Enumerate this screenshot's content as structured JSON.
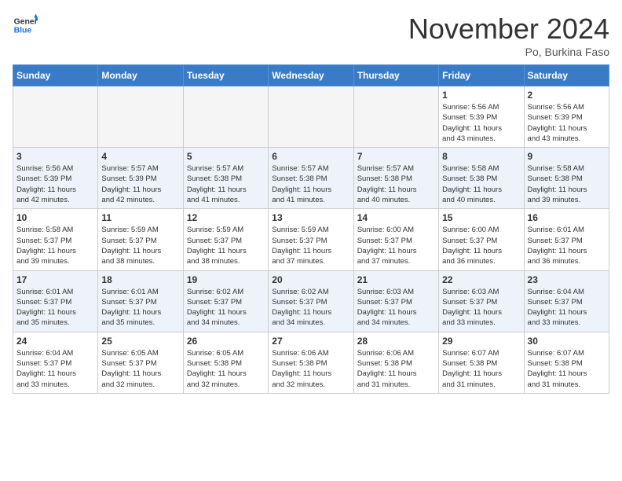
{
  "header": {
    "logo": {
      "general": "General",
      "blue": "Blue"
    },
    "month": "November 2024",
    "location": "Po, Burkina Faso"
  },
  "weekdays": [
    "Sunday",
    "Monday",
    "Tuesday",
    "Wednesday",
    "Thursday",
    "Friday",
    "Saturday"
  ],
  "weeks": [
    [
      {
        "day": "",
        "info": ""
      },
      {
        "day": "",
        "info": ""
      },
      {
        "day": "",
        "info": ""
      },
      {
        "day": "",
        "info": ""
      },
      {
        "day": "",
        "info": ""
      },
      {
        "day": "1",
        "info": "Sunrise: 5:56 AM\nSunset: 5:39 PM\nDaylight: 11 hours\nand 43 minutes."
      },
      {
        "day": "2",
        "info": "Sunrise: 5:56 AM\nSunset: 5:39 PM\nDaylight: 11 hours\nand 43 minutes."
      }
    ],
    [
      {
        "day": "3",
        "info": "Sunrise: 5:56 AM\nSunset: 5:39 PM\nDaylight: 11 hours\nand 42 minutes."
      },
      {
        "day": "4",
        "info": "Sunrise: 5:57 AM\nSunset: 5:39 PM\nDaylight: 11 hours\nand 42 minutes."
      },
      {
        "day": "5",
        "info": "Sunrise: 5:57 AM\nSunset: 5:38 PM\nDaylight: 11 hours\nand 41 minutes."
      },
      {
        "day": "6",
        "info": "Sunrise: 5:57 AM\nSunset: 5:38 PM\nDaylight: 11 hours\nand 41 minutes."
      },
      {
        "day": "7",
        "info": "Sunrise: 5:57 AM\nSunset: 5:38 PM\nDaylight: 11 hours\nand 40 minutes."
      },
      {
        "day": "8",
        "info": "Sunrise: 5:58 AM\nSunset: 5:38 PM\nDaylight: 11 hours\nand 40 minutes."
      },
      {
        "day": "9",
        "info": "Sunrise: 5:58 AM\nSunset: 5:38 PM\nDaylight: 11 hours\nand 39 minutes."
      }
    ],
    [
      {
        "day": "10",
        "info": "Sunrise: 5:58 AM\nSunset: 5:37 PM\nDaylight: 11 hours\nand 39 minutes."
      },
      {
        "day": "11",
        "info": "Sunrise: 5:59 AM\nSunset: 5:37 PM\nDaylight: 11 hours\nand 38 minutes."
      },
      {
        "day": "12",
        "info": "Sunrise: 5:59 AM\nSunset: 5:37 PM\nDaylight: 11 hours\nand 38 minutes."
      },
      {
        "day": "13",
        "info": "Sunrise: 5:59 AM\nSunset: 5:37 PM\nDaylight: 11 hours\nand 37 minutes."
      },
      {
        "day": "14",
        "info": "Sunrise: 6:00 AM\nSunset: 5:37 PM\nDaylight: 11 hours\nand 37 minutes."
      },
      {
        "day": "15",
        "info": "Sunrise: 6:00 AM\nSunset: 5:37 PM\nDaylight: 11 hours\nand 36 minutes."
      },
      {
        "day": "16",
        "info": "Sunrise: 6:01 AM\nSunset: 5:37 PM\nDaylight: 11 hours\nand 36 minutes."
      }
    ],
    [
      {
        "day": "17",
        "info": "Sunrise: 6:01 AM\nSunset: 5:37 PM\nDaylight: 11 hours\nand 35 minutes."
      },
      {
        "day": "18",
        "info": "Sunrise: 6:01 AM\nSunset: 5:37 PM\nDaylight: 11 hours\nand 35 minutes."
      },
      {
        "day": "19",
        "info": "Sunrise: 6:02 AM\nSunset: 5:37 PM\nDaylight: 11 hours\nand 34 minutes."
      },
      {
        "day": "20",
        "info": "Sunrise: 6:02 AM\nSunset: 5:37 PM\nDaylight: 11 hours\nand 34 minutes."
      },
      {
        "day": "21",
        "info": "Sunrise: 6:03 AM\nSunset: 5:37 PM\nDaylight: 11 hours\nand 34 minutes."
      },
      {
        "day": "22",
        "info": "Sunrise: 6:03 AM\nSunset: 5:37 PM\nDaylight: 11 hours\nand 33 minutes."
      },
      {
        "day": "23",
        "info": "Sunrise: 6:04 AM\nSunset: 5:37 PM\nDaylight: 11 hours\nand 33 minutes."
      }
    ],
    [
      {
        "day": "24",
        "info": "Sunrise: 6:04 AM\nSunset: 5:37 PM\nDaylight: 11 hours\nand 33 minutes."
      },
      {
        "day": "25",
        "info": "Sunrise: 6:05 AM\nSunset: 5:37 PM\nDaylight: 11 hours\nand 32 minutes."
      },
      {
        "day": "26",
        "info": "Sunrise: 6:05 AM\nSunset: 5:38 PM\nDaylight: 11 hours\nand 32 minutes."
      },
      {
        "day": "27",
        "info": "Sunrise: 6:06 AM\nSunset: 5:38 PM\nDaylight: 11 hours\nand 32 minutes."
      },
      {
        "day": "28",
        "info": "Sunrise: 6:06 AM\nSunset: 5:38 PM\nDaylight: 11 hours\nand 31 minutes."
      },
      {
        "day": "29",
        "info": "Sunrise: 6:07 AM\nSunset: 5:38 PM\nDaylight: 11 hours\nand 31 minutes."
      },
      {
        "day": "30",
        "info": "Sunrise: 6:07 AM\nSunset: 5:38 PM\nDaylight: 11 hours\nand 31 minutes."
      }
    ]
  ]
}
